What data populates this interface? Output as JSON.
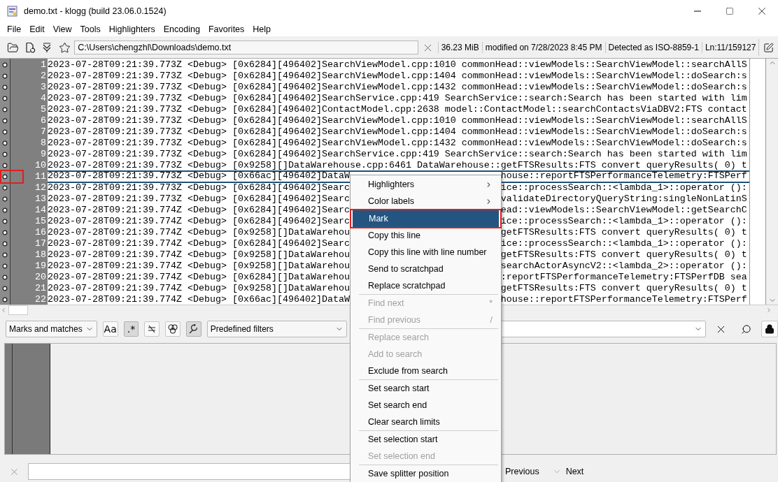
{
  "window": {
    "title": "demo.txt - klogg (build 23.06.0.1524)"
  },
  "menu_bar": [
    "File",
    "Edit",
    "View",
    "Tools",
    "Highlighters",
    "Encoding",
    "Favorites",
    "Help"
  ],
  "toolbar": {
    "path": "C:\\Users\\chengzhl\\Downloads\\demo.txt",
    "file_size": "36.23 MiB",
    "modified": "modified on 7/28/2023 8:45 PM",
    "encoding": "Detected as ISO-8859-1",
    "position": "Ln:11/159127"
  },
  "log_lines": [
    {
      "number": "1",
      "text": "2023-07-28T09:21:39.773Z <Debug> [0x6284][496402]SearchViewModel.cpp:1010 commonHead::viewModels::SearchViewModel::searchAllS",
      "selected": false,
      "annotated": false
    },
    {
      "number": "2",
      "text": "2023-07-28T09:21:39.773Z <Debug> [0x6284][496402]SearchViewModel.cpp:1404 commonHead::viewModels::SearchViewModel::doSearch:s",
      "selected": false,
      "annotated": false
    },
    {
      "number": "3",
      "text": "2023-07-28T09:21:39.773Z <Debug> [0x6284][496402]SearchViewModel.cpp:1432 commonHead::viewModels::SearchViewModel::doSearch:s",
      "selected": false,
      "annotated": false
    },
    {
      "number": "4",
      "text": "2023-07-28T09:21:39.773Z <Debug> [0x6284][496402]SearchService.cpp:419 SearchService::search:Search has been started with lim",
      "selected": false,
      "annotated": false
    },
    {
      "number": "5",
      "text": "2023-07-28T09:21:39.773Z <Debug> [0x6284][496402]ContactModel.cpp:2638 model::ContactModel::searchContactsViaDBV2:FTS contact",
      "selected": false,
      "annotated": false
    },
    {
      "number": "6",
      "text": "2023-07-28T09:21:39.773Z <Debug> [0x6284][496402]SearchViewModel.cpp:1010 commonHead::viewModels::SearchViewModel::searchAllS",
      "selected": false,
      "annotated": false
    },
    {
      "number": "7",
      "text": "2023-07-28T09:21:39.773Z <Debug> [0x6284][496402]SearchViewModel.cpp:1404 commonHead::viewModels::SearchViewModel::doSearch:s",
      "selected": false,
      "annotated": false
    },
    {
      "number": "8",
      "text": "2023-07-28T09:21:39.773Z <Debug> [0x6284][496402]SearchViewModel.cpp:1432 commonHead::viewModels::SearchViewModel::doSearch:s",
      "selected": false,
      "annotated": false
    },
    {
      "number": "9",
      "text": "2023-07-28T09:21:39.773Z <Debug> [0x6284][496402]SearchService.cpp:419 SearchService::search:Search has been started with lim",
      "selected": false,
      "annotated": false
    },
    {
      "number": "10",
      "text": "2023-07-28T09:21:39.773Z <Debug> [0x9258][]DataWarehouse.cpp:6461 DataWarehouse::getFTSResults:FTS convert queryResults( 0) t",
      "selected": false,
      "annotated": false
    },
    {
      "number": "11",
      "text": "2023-07-28T09:21:39.773Z <Debug> [0x66ac][496402]DataW",
      "text_after_menu": "house::reportFTSPerformanceTelemetry:FTSPerf",
      "selected": true,
      "annotated": true
    },
    {
      "number": "12",
      "text": "2023-07-28T09:21:39.773Z <Debug> [0x6284][496402]Searc",
      "text_after_menu": "ice::processSearch::<lambda_1>::operator ():",
      "selected": false,
      "annotated": false
    },
    {
      "number": "13",
      "text": "2023-07-28T09:21:39.773Z <Debug> [0x6284][496402]Searc",
      "text_after_menu": "validateDirectoryQueryString:singleNonLatinS",
      "selected": false,
      "annotated": false
    },
    {
      "number": "14",
      "text": "2023-07-28T09:21:39.774Z <Debug> [0x6284][496402]Searc",
      "text_after_menu": "ead::viewModels::SearchViewModel::getSearchC",
      "selected": false,
      "annotated": false
    },
    {
      "number": "15",
      "text": "2023-07-28T09:21:39.774Z <Debug> [0x6284][496402]Searc",
      "text_after_menu": "ice::processSearch::<lambda_1>::operator ():",
      "selected": false,
      "annotated": false
    },
    {
      "number": "16",
      "text": "2023-07-28T09:21:39.774Z <Debug> [0x9258][]DataWarehou",
      "text_after_menu": "getFTSResults:FTS convert queryResults( 0) t",
      "selected": false,
      "annotated": false
    },
    {
      "number": "17",
      "text": "2023-07-28T09:21:39.774Z <Debug> [0x6284][496402]Searc",
      "text_after_menu": "ice::processSearch::<lambda_1>::operator ():",
      "selected": false,
      "annotated": false
    },
    {
      "number": "18",
      "text": "2023-07-28T09:21:39.774Z <Debug> [0x9258][]DataWarehou",
      "text_after_menu": "getFTSResults:FTS convert queryResults( 0) t",
      "selected": false,
      "annotated": false
    },
    {
      "number": "19",
      "text": "2023-07-28T09:21:39.774Z <Debug> [0x9258][]DataWarehou",
      "text_after_menu": "searchActorAsyncV2::<lambda_2>::operator ():",
      "selected": false,
      "annotated": false
    },
    {
      "number": "20",
      "text": "2023-07-28T09:21:39.774Z <Debug> [0x6284][]DataWarehou",
      "text_after_menu": ":reportFTSPerformanceTelemetry:FTSPerfDB sea",
      "selected": false,
      "annotated": false
    },
    {
      "number": "21",
      "text": "2023-07-28T09:21:39.774Z <Debug> [0x9258][]DataWarehou",
      "text_after_menu": "getFTSResults:FTS convert queryResults( 0) t",
      "selected": false,
      "annotated": false
    },
    {
      "number": "22",
      "text": "2023-07-28T09:21:39.774Z <Debug> [0x66ac][496402]DataW",
      "text_after_menu": "house::reportFTSPerformanceTelemetry:FTSPerf",
      "selected": false,
      "annotated": false
    }
  ],
  "filter_bar": {
    "view_mode": "Marks and matches",
    "buttons": [
      {
        "kind": "text",
        "label": "Aa",
        "pressed": false
      },
      {
        "kind": "text",
        "label": ".*",
        "pressed": true
      },
      {
        "kind": "inverse",
        "pressed": false
      },
      {
        "kind": "boolean",
        "pressed": false
      },
      {
        "kind": "autorefresh",
        "pressed": true
      }
    ],
    "predefined_filters": "Predefined filters"
  },
  "context_menu": [
    {
      "kind": "item",
      "label": "Highlighters",
      "submenu": true,
      "disabled": false,
      "selected": false,
      "annotated": false
    },
    {
      "kind": "item",
      "label": "Color labels",
      "submenu": true,
      "disabled": false,
      "selected": false,
      "annotated": false
    },
    {
      "kind": "separator"
    },
    {
      "kind": "item",
      "label": "Mark",
      "submenu": false,
      "disabled": false,
      "selected": true,
      "annotated": true
    },
    {
      "kind": "item",
      "label": "Copy this line",
      "submenu": false,
      "disabled": false,
      "selected": false,
      "annotated": false
    },
    {
      "kind": "item",
      "label": "Copy this line with line number",
      "submenu": false,
      "disabled": false,
      "selected": false,
      "annotated": false
    },
    {
      "kind": "item",
      "label": "Send to scratchpad",
      "submenu": false,
      "disabled": false,
      "selected": false,
      "annotated": false
    },
    {
      "kind": "item",
      "label": "Replace scratchpad",
      "submenu": false,
      "disabled": false,
      "selected": false,
      "annotated": false
    },
    {
      "kind": "separator"
    },
    {
      "kind": "item",
      "label": "Find next",
      "shortcut": "*",
      "submenu": false,
      "disabled": true,
      "selected": false,
      "annotated": false
    },
    {
      "kind": "item",
      "label": "Find previous",
      "shortcut": "/",
      "submenu": false,
      "disabled": true,
      "selected": false,
      "annotated": false
    },
    {
      "kind": "separator"
    },
    {
      "kind": "item",
      "label": "Replace search",
      "submenu": false,
      "disabled": true,
      "selected": false,
      "annotated": false
    },
    {
      "kind": "item",
      "label": "Add to search",
      "submenu": false,
      "disabled": true,
      "selected": false,
      "annotated": false
    },
    {
      "kind": "item",
      "label": "Exclude from search",
      "submenu": false,
      "disabled": false,
      "selected": false,
      "annotated": false
    },
    {
      "kind": "separator"
    },
    {
      "kind": "item",
      "label": "Set search start",
      "submenu": false,
      "disabled": false,
      "selected": false,
      "annotated": false
    },
    {
      "kind": "item",
      "label": "Set search end",
      "submenu": false,
      "disabled": false,
      "selected": false,
      "annotated": false
    },
    {
      "kind": "item",
      "label": "Clear search limits",
      "submenu": false,
      "disabled": false,
      "selected": false,
      "annotated": false
    },
    {
      "kind": "separator"
    },
    {
      "kind": "item",
      "label": "Set selection start",
      "submenu": false,
      "disabled": false,
      "selected": false,
      "annotated": false
    },
    {
      "kind": "item",
      "label": "Set selection end",
      "submenu": false,
      "disabled": true,
      "selected": false,
      "annotated": false
    },
    {
      "kind": "separator"
    },
    {
      "kind": "item",
      "label": "Save splitter position",
      "submenu": false,
      "disabled": false,
      "selected": false,
      "annotated": false
    }
  ],
  "search_bar": {
    "previous": "Previous",
    "next": "Next"
  }
}
